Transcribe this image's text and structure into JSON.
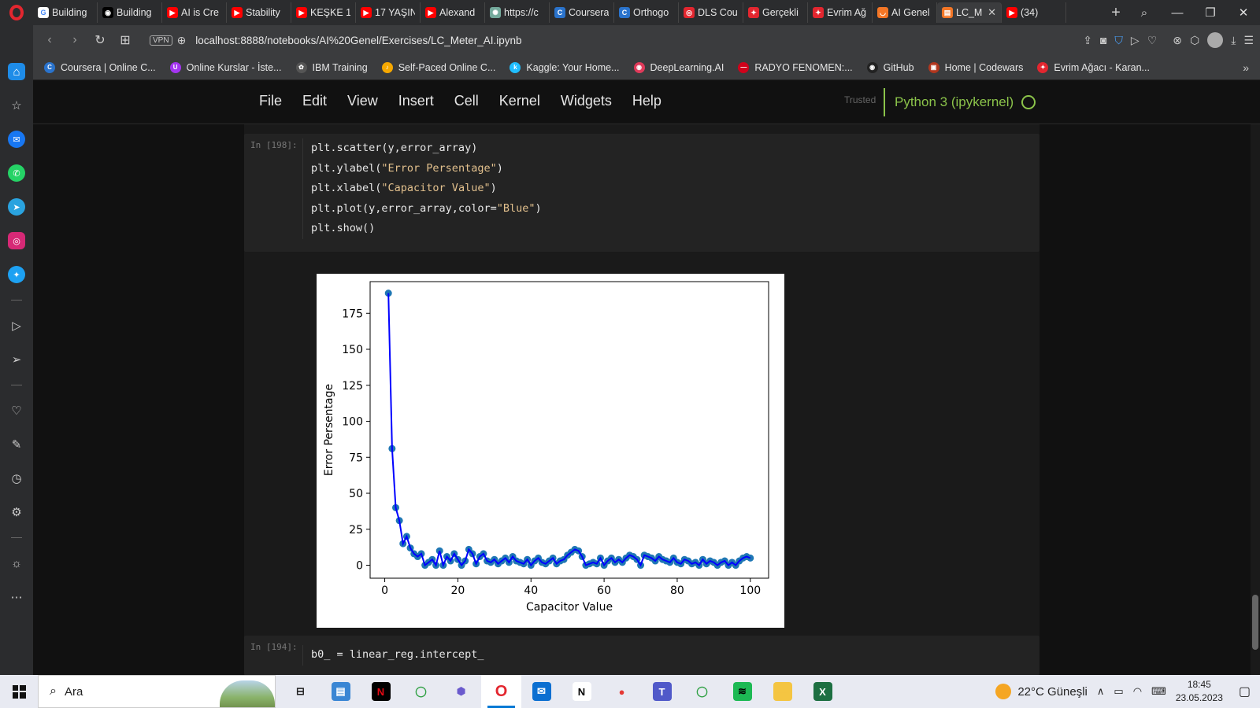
{
  "tabs": [
    {
      "title": "Building",
      "fav": "G",
      "color": "#ffffff",
      "fg": "#4285f4"
    },
    {
      "title": "Building",
      "fav": "◉",
      "color": "#000000",
      "fg": "#ffffff"
    },
    {
      "title": "AI is Cre",
      "fav": "▶",
      "color": "#ff0000",
      "fg": "#ffffff"
    },
    {
      "title": "Stability",
      "fav": "▶",
      "color": "#ff0000",
      "fg": "#ffffff"
    },
    {
      "title": "KEŞKE 1",
      "fav": "▶",
      "color": "#ff0000",
      "fg": "#ffffff"
    },
    {
      "title": "17 YAŞIN",
      "fav": "▶",
      "color": "#ff0000",
      "fg": "#ffffff"
    },
    {
      "title": "Alexand",
      "fav": "▶",
      "color": "#ff0000",
      "fg": "#ffffff"
    },
    {
      "title": "https://c",
      "fav": "✺",
      "color": "#74aa9c",
      "fg": "#ffffff"
    },
    {
      "title": "Coursera",
      "fav": "C",
      "color": "#2a73cc",
      "fg": "#ffffff"
    },
    {
      "title": "Orthogo",
      "fav": "C",
      "color": "#2a73cc",
      "fg": "#ffffff"
    },
    {
      "title": "DLS Cou",
      "fav": "◎",
      "color": "#e3262f",
      "fg": "#ffffff"
    },
    {
      "title": "Gerçekli",
      "fav": "✦",
      "color": "#e3262f",
      "fg": "#ffffff"
    },
    {
      "title": "Evrim Ağ",
      "fav": "✦",
      "color": "#e3262f",
      "fg": "#ffffff"
    },
    {
      "title": "AI Genel",
      "fav": "◡",
      "color": "#f37626",
      "fg": "#ffffff"
    },
    {
      "title": "LC_M",
      "fav": "▤",
      "color": "#f37626",
      "fg": "#ffffff",
      "active": true
    },
    {
      "title": "(34)",
      "fav": "▶",
      "color": "#ff0000",
      "fg": "#ffffff"
    }
  ],
  "address": {
    "url": "localhost:8888/notebooks/AI%20Genel/Exercises/LC_Meter_AI.ipynb",
    "vpn": "VPN"
  },
  "bookmarks": [
    {
      "label": "Coursera | Online C...",
      "fav": "C",
      "color": "#2a73cc"
    },
    {
      "label": "Online Kurslar - İste...",
      "fav": "U",
      "color": "#a435f0"
    },
    {
      "label": "IBM Training",
      "fav": "✿",
      "color": "#555555"
    },
    {
      "label": "Self-Paced Online C...",
      "fav": "♪",
      "color": "#f6a800"
    },
    {
      "label": "Kaggle: Your Home...",
      "fav": "k",
      "color": "#20beff"
    },
    {
      "label": "DeepLearning.AI",
      "fav": "◉",
      "color": "#e03a5a"
    },
    {
      "label": "RADYO FENOMEN:...",
      "fav": "—",
      "color": "#d0021b"
    },
    {
      "label": "GitHub",
      "fav": "◉",
      "color": "#222222"
    },
    {
      "label": "Home | Codewars",
      "fav": "▣",
      "color": "#b1361e"
    },
    {
      "label": "Evrim Ağacı - Karan...",
      "fav": "✦",
      "color": "#e3262f"
    }
  ],
  "menu": {
    "items": [
      "File",
      "Edit",
      "View",
      "Insert",
      "Cell",
      "Kernel",
      "Widgets",
      "Help"
    ],
    "trusted": "Trusted",
    "kernel": "Python 3 (ipykernel)"
  },
  "cell1": {
    "prompt": "In [198]:",
    "lines": [
      [
        [
          "plt.scatter(y,error_array)",
          ""
        ]
      ],
      [
        [
          "plt.ylabel(",
          ""
        ],
        [
          "\"Error Persentage\"",
          "str"
        ],
        [
          ")",
          ""
        ]
      ],
      [
        [
          "plt.xlabel(",
          ""
        ],
        [
          "\"Capacitor Value\"",
          "str"
        ],
        [
          ")",
          ""
        ]
      ],
      [
        [
          "plt.plot(y,error_array,color=",
          ""
        ],
        [
          "\"Blue\"",
          "str"
        ],
        [
          ")",
          ""
        ]
      ],
      [
        [
          "plt.show()",
          ""
        ]
      ]
    ]
  },
  "cell2": {
    "prompt": "In [194]:",
    "code": "b0_ = linear_reg.intercept_"
  },
  "chart_data": {
    "type": "line",
    "xlabel": "Capacitor Value",
    "ylabel": "Error Persentage",
    "xlim": [
      -4,
      105
    ],
    "ylim": [
      -9,
      197
    ],
    "xticks": [
      0,
      20,
      40,
      60,
      80,
      100
    ],
    "yticks": [
      0,
      25,
      50,
      75,
      100,
      125,
      150,
      175
    ],
    "color": "#0000ff",
    "marker_color": "#1f77b4",
    "series": [
      {
        "x": [
          1,
          2,
          3,
          4,
          5,
          6,
          7,
          8,
          9,
          10,
          11,
          12,
          13,
          14,
          15,
          16,
          17,
          18,
          19,
          20,
          21,
          22,
          23,
          24,
          25,
          26,
          27,
          28,
          29,
          30,
          31,
          32,
          33,
          34,
          35,
          36,
          37,
          38,
          39,
          40,
          41,
          42,
          43,
          44,
          45,
          46,
          47,
          48,
          49,
          50,
          51,
          52,
          53,
          54,
          55,
          56,
          57,
          58,
          59,
          60,
          61,
          62,
          63,
          64,
          65,
          66,
          67,
          68,
          69,
          70,
          71,
          72,
          73,
          74,
          75,
          76,
          77,
          78,
          79,
          80,
          81,
          82,
          83,
          84,
          85,
          86,
          87,
          88,
          89,
          90,
          91,
          92,
          93,
          94,
          95,
          96,
          97,
          98,
          99,
          100
        ],
        "y": [
          189,
          81,
          40,
          31,
          15,
          20,
          12,
          8,
          6,
          8,
          0,
          2,
          4,
          0,
          10,
          0,
          6,
          3,
          8,
          4,
          0,
          3,
          11,
          8,
          1,
          6,
          8,
          3,
          2,
          4,
          1,
          3,
          5,
          2,
          6,
          3,
          2,
          1,
          4,
          0,
          3,
          5,
          2,
          1,
          3,
          5,
          1,
          3,
          4,
          7,
          9,
          11,
          10,
          6,
          0,
          1,
          2,
          1,
          5,
          0,
          3,
          5,
          2,
          4,
          2,
          5,
          7,
          6,
          4,
          0,
          7,
          6,
          5,
          3,
          6,
          4,
          3,
          2,
          5,
          2,
          1,
          4,
          3,
          1,
          2,
          0,
          4,
          1,
          3,
          2,
          0,
          2,
          3,
          0,
          2,
          0,
          3,
          5,
          6,
          5
        ]
      }
    ]
  },
  "taskbar": {
    "search_placeholder": "Ara",
    "weather": "22°C  Güneşli",
    "time": "18:45",
    "date": "23.05.2023",
    "apps": [
      {
        "name": "taskview",
        "glyph": "⊟",
        "color": "transparent",
        "fg": "#222222"
      },
      {
        "name": "explorer-blue",
        "glyph": "▤",
        "color": "#3a86d4",
        "fg": "#ffffff"
      },
      {
        "name": "netflix",
        "glyph": "N",
        "color": "#000000",
        "fg": "#e50914"
      },
      {
        "name": "ring-green",
        "glyph": "◯",
        "color": "transparent",
        "fg": "#2ea043"
      },
      {
        "name": "app-hex",
        "glyph": "⬢",
        "color": "transparent",
        "fg": "#6a5acd"
      },
      {
        "name": "opera",
        "glyph": "O",
        "color": "transparent",
        "fg": "#e3262f",
        "active": true
      },
      {
        "name": "mail",
        "glyph": "✉",
        "color": "#0b6fd1",
        "fg": "#ffffff"
      },
      {
        "name": "notion",
        "glyph": "N",
        "color": "#ffffff",
        "fg": "#000000"
      },
      {
        "name": "tomato",
        "glyph": "●",
        "color": "transparent",
        "fg": "#e53935"
      },
      {
        "name": "teams",
        "glyph": "T",
        "color": "#5059c9",
        "fg": "#ffffff"
      },
      {
        "name": "ring-green-2",
        "glyph": "◯",
        "color": "transparent",
        "fg": "#2ea043"
      },
      {
        "name": "spotify",
        "glyph": "≋",
        "color": "#1db954",
        "fg": "#000000"
      },
      {
        "name": "folder",
        "glyph": "▬",
        "color": "#f4c542",
        "fg": "#f4c542"
      },
      {
        "name": "excel",
        "glyph": "X",
        "color": "#1d6f42",
        "fg": "#ffffff"
      }
    ]
  }
}
